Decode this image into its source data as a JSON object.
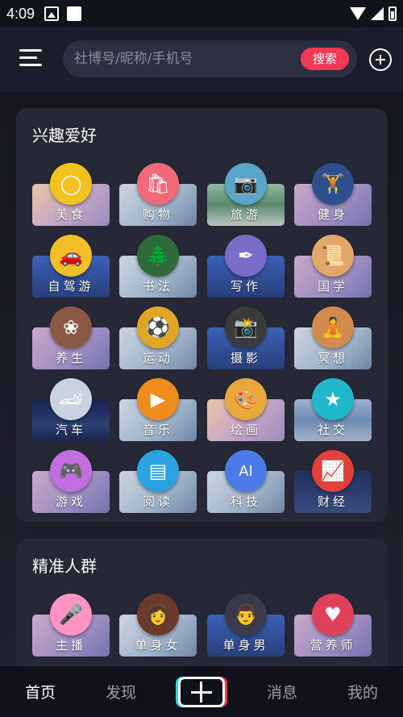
{
  "status": {
    "time": "4:09"
  },
  "search": {
    "placeholder": "社博号/昵称/手机号",
    "button": "搜索"
  },
  "interests": {
    "title": "兴趣爱好",
    "items": [
      {
        "label": "美食",
        "icon": "ring-icon",
        "glyph": "◯",
        "color": "#f3c21e",
        "bg": "bg-warm"
      },
      {
        "label": "购物",
        "icon": "shopping-bag-icon",
        "glyph": "🛍",
        "color": "#f26a79",
        "bg": "bg-mist"
      },
      {
        "label": "旅游",
        "icon": "camera-icon",
        "glyph": "📷",
        "color": "#58a6c9",
        "bg": "bg-green"
      },
      {
        "label": "健身",
        "icon": "dumbbell-icon",
        "glyph": "🏋",
        "color": "#2f4f8c",
        "bg": "bg-pink"
      },
      {
        "label": "自驾游",
        "icon": "car-icon",
        "glyph": "🚗",
        "color": "#f1c027",
        "bg": "bg-blue"
      },
      {
        "label": "书法",
        "icon": "pine-tree-icon",
        "glyph": "🌲",
        "color": "#2f6b3a",
        "bg": "bg-mist"
      },
      {
        "label": "写作",
        "icon": "feather-icon",
        "glyph": "✒",
        "color": "#7a6cc9",
        "bg": "bg-blue"
      },
      {
        "label": "国学",
        "icon": "scholar-icon",
        "glyph": "📜",
        "color": "#e2a86a",
        "bg": "bg-pink"
      },
      {
        "label": "养生",
        "icon": "lotus-icon",
        "glyph": "❀",
        "color": "#8a5a44",
        "bg": "bg-pink"
      },
      {
        "label": "运动",
        "icon": "ball-icon",
        "glyph": "⚽",
        "color": "#e0a524",
        "bg": "bg-mist"
      },
      {
        "label": "摄影",
        "icon": "camera-lens-icon",
        "glyph": "📸",
        "color": "#3b3b3b",
        "bg": "bg-blue"
      },
      {
        "label": "冥想",
        "icon": "meditation-icon",
        "glyph": "🧘",
        "color": "#d38a4e",
        "bg": "bg-mist"
      },
      {
        "label": "汽车",
        "icon": "sports-car-icon",
        "glyph": "🏎",
        "color": "#c9d2df",
        "bg": "bg-dark"
      },
      {
        "label": "音乐",
        "icon": "music-player-icon",
        "glyph": "▶",
        "color": "#f08c1e",
        "bg": "bg-mist"
      },
      {
        "label": "绘画",
        "icon": "palette-icon",
        "glyph": "🎨",
        "color": "#e8a93a",
        "bg": "bg-warm"
      },
      {
        "label": "社交",
        "icon": "chat-star-icon",
        "glyph": "★",
        "color": "#1fb7c9",
        "bg": "bg-teal"
      },
      {
        "label": "游戏",
        "icon": "gamepad-icon",
        "glyph": "🎮",
        "color": "#c26de0",
        "bg": "bg-pink"
      },
      {
        "label": "阅读",
        "icon": "reader-app-icon",
        "glyph": "▤",
        "color": "#2ba3e0",
        "bg": "bg-mist"
      },
      {
        "label": "科技",
        "icon": "ai-cube-icon",
        "glyph": "AI",
        "color": "#4b7be6",
        "bg": "bg-mist"
      },
      {
        "label": "财经",
        "icon": "bar-chart-icon",
        "glyph": "📈",
        "color": "#e0413a",
        "bg": "bg-navy"
      }
    ]
  },
  "audience": {
    "title": "精准人群",
    "items": [
      {
        "label": "主播",
        "icon": "microphone-icon",
        "glyph": "🎤",
        "color": "#ff93c4",
        "bg": "bg-pink"
      },
      {
        "label": "单身女",
        "icon": "woman-avatar-icon",
        "glyph": "👩",
        "color": "#6b3a2a",
        "bg": "bg-mist"
      },
      {
        "label": "单身男",
        "icon": "man-avatar-icon",
        "glyph": "👨",
        "color": "#3a3a4a",
        "bg": "bg-blue"
      },
      {
        "label": "营养师",
        "icon": "heart-fork-icon",
        "glyph": "♥",
        "color": "#e0415a",
        "bg": "bg-pink"
      }
    ]
  },
  "nav": {
    "home": "首页",
    "discover": "发现",
    "messages": "消息",
    "mine": "我的"
  }
}
